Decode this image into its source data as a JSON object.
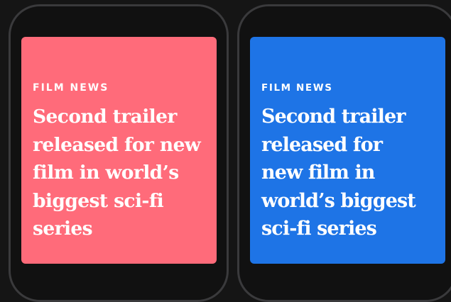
{
  "cards": [
    {
      "category": "FILM NEWS",
      "headline_lines": [
        "Second trailer",
        "released for new",
        "film in world’s",
        "biggest sci-fi",
        "series"
      ],
      "background": "#ff6b7a"
    },
    {
      "category": "FILM NEWS",
      "headline_lines": [
        "Second trailer",
        "released for",
        "new film in",
        "world’s biggest",
        "sci-fi series"
      ],
      "background": "#1e74e6"
    }
  ]
}
